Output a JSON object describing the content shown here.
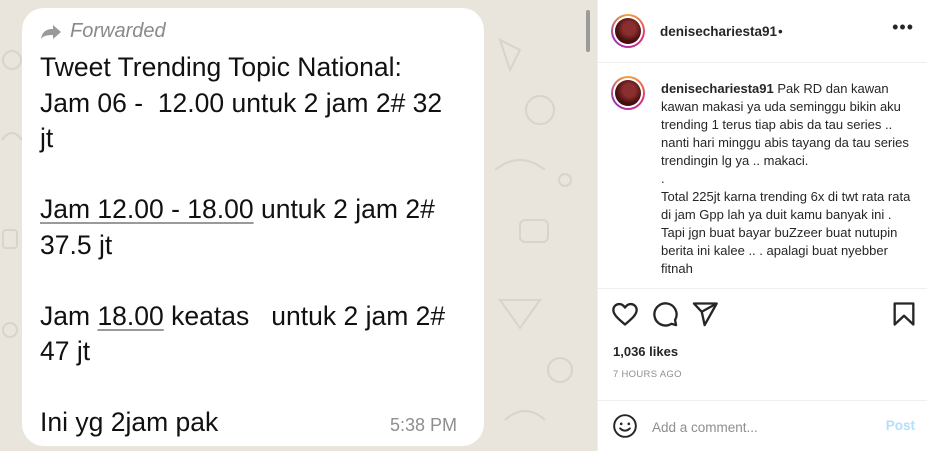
{
  "chat": {
    "forwarded_label": "Forwarded",
    "line1": "Tweet Trending Topic National:",
    "line2": "Jam 06 -  12.00 untuk 2 jam 2# 32",
    "line3": "jt",
    "line4a": "Jam 12.00 - 18.00",
    "line4b": " untuk 2 jam 2#",
    "line5": "37.5 jt",
    "line6a": "Jam ",
    "line6b": "18.00",
    "line6c": " keatas   untuk 2 jam 2#",
    "line7": "47 jt",
    "line8": "Ini yg 2jam pak",
    "time": "5:38 PM"
  },
  "header": {
    "username": "denisechariesta91",
    "dot": "•",
    "more_icon": "more-dots-icon"
  },
  "caption": {
    "username": "denisechariesta91",
    "text": " Pak RD dan kawan kawan makasi ya uda seminggu bikin aku trending 1 terus tiap abis da tau series .. nanti hari minggu abis tayang da tau series trendingin lg ya .. makaci.\n.\nTotal 225jt karna trending 6x di twt rata rata di jam Gpp lah ya duit kamu banyak ini . Tapi jgn buat bayar buZzeer buat nutupin berita ini kalee .. . apalagi buat nyebber fitnah"
  },
  "actions": {
    "like_icon": "heart-icon",
    "comment_icon": "comment-icon",
    "share_icon": "send-icon",
    "save_icon": "bookmark-icon"
  },
  "likes": "1,036 likes",
  "time_ago": "7 HOURS AGO",
  "comment_box": {
    "placeholder": "Add a comment...",
    "post_label": "Post",
    "emoji_icon": "smiley-icon"
  }
}
